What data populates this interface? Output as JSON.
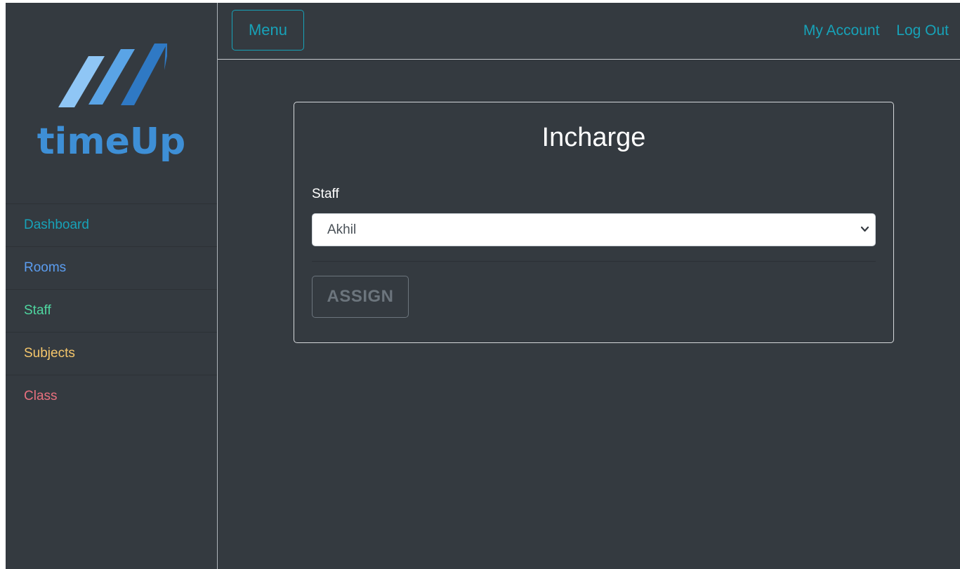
{
  "brand": {
    "name": "timeUp",
    "logo_icon": "stripes-logo-icon",
    "color": "#3e8fd6"
  },
  "sidebar": {
    "items": [
      {
        "label": "Dashboard",
        "color": "#17a2b8"
      },
      {
        "label": "Rooms",
        "color": "#5b9df0"
      },
      {
        "label": "Staff",
        "color": "#4fd6a0"
      },
      {
        "label": "Subjects",
        "color": "#f5c66b"
      },
      {
        "label": "Class",
        "color": "#e8707e"
      }
    ]
  },
  "topbar": {
    "menu_label": "Menu",
    "my_account_label": "My Account",
    "logout_label": "Log Out"
  },
  "card": {
    "title": "Incharge",
    "staff_label": "Staff",
    "staff_selected": "Akhil",
    "assign_label": "ASSIGN",
    "select_icon": "chevron-down-icon"
  },
  "colors": {
    "background": "#343a40",
    "accent": "#17a2b8",
    "muted": "#6c757d"
  }
}
